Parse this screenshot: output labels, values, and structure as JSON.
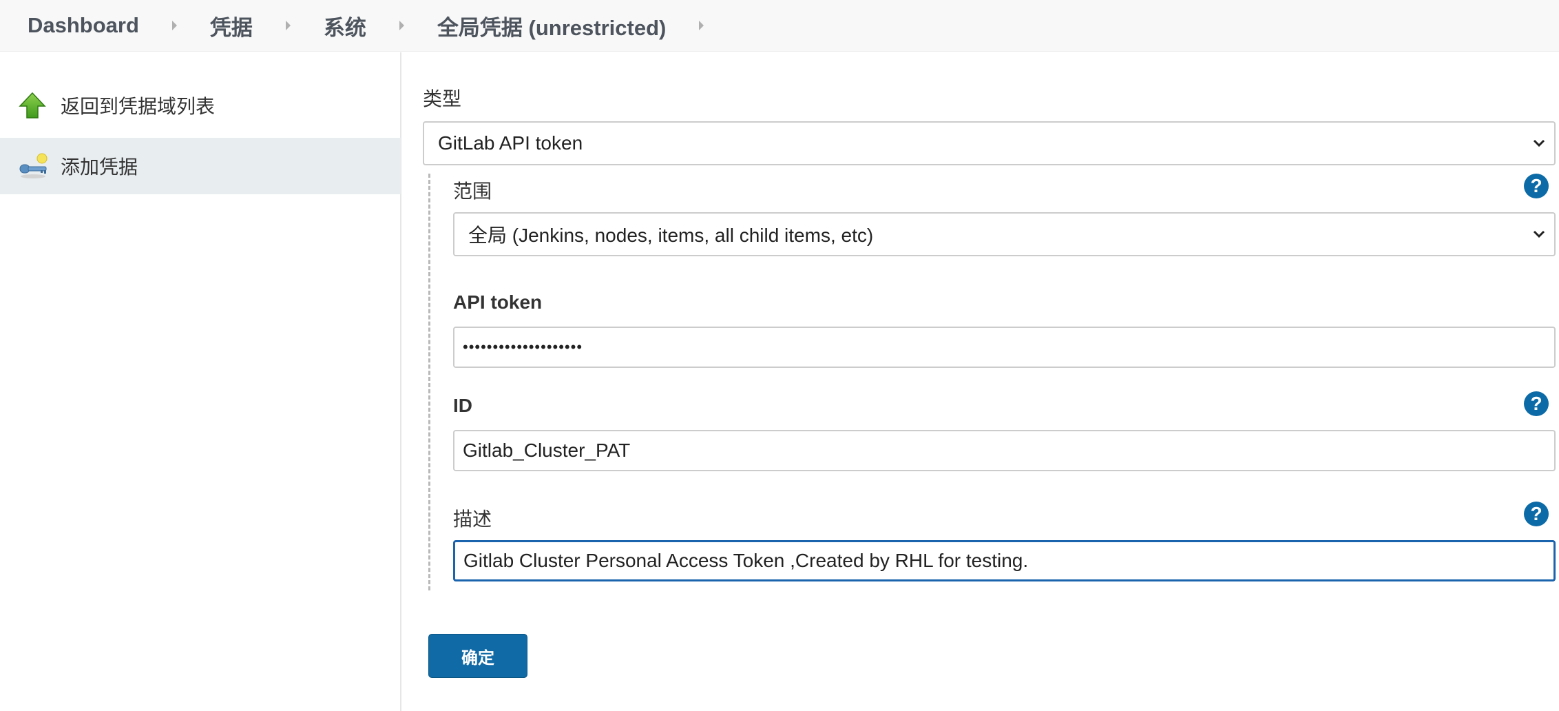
{
  "breadcrumb": [
    {
      "label": "Dashboard"
    },
    {
      "label": "凭据"
    },
    {
      "label": "系统"
    },
    {
      "label": "全局凭据 (unrestricted)"
    }
  ],
  "sidebar": {
    "items": [
      {
        "label": "返回到凭据域列表",
        "icon": "green-up-arrow-icon"
      },
      {
        "label": "添加凭据",
        "icon": "key-icon",
        "active": true
      }
    ]
  },
  "form": {
    "kind_label": "类型",
    "kind_value": "GitLab API token",
    "scope_label": "范围",
    "scope_value": "全局 (Jenkins, nodes, items, all child items, etc)",
    "token_label": "API token",
    "token_value": "••••••••••••••••••••",
    "id_label": "ID",
    "id_value": "Gitlab_Cluster_PAT",
    "desc_label": "描述",
    "desc_value": "Gitlab Cluster Personal Access Token ,Created by RHL for testing.",
    "help_glyph": "?",
    "submit_label": "确定"
  },
  "colors": {
    "accent": "#0f6aa6",
    "focus_border": "#1a63ad",
    "active_sidebar": "#e8edf0"
  }
}
